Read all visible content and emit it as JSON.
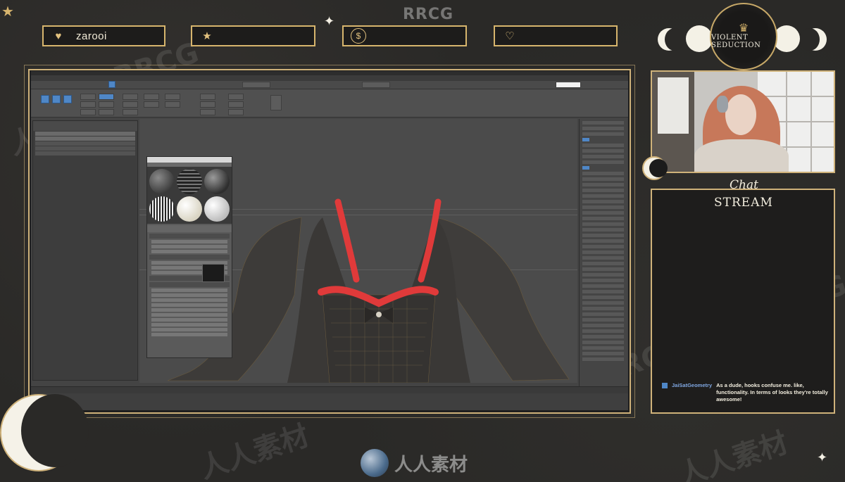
{
  "overlay": {
    "alerts": [
      {
        "icon": "heart-icon",
        "glyph": "♥",
        "label": "zarooi"
      },
      {
        "icon": "star-icon",
        "glyph": "★",
        "label": ""
      },
      {
        "icon": "dollar-icon",
        "glyph": "$",
        "label": ""
      },
      {
        "icon": "gift-hand-icon",
        "glyph": "♡",
        "label": ""
      }
    ],
    "brand": {
      "title": "VIOLENT SEDUCTION"
    },
    "chat": {
      "title": "Chat",
      "subtitle": "STREAM",
      "messages": [
        {
          "user": "JaiSatGeometry",
          "text": "As a dude, hooks confuse me. like, functionality. In terms of looks they're totally awesome!"
        }
      ]
    },
    "colors": {
      "accent_gold": "#cfb27a",
      "background": "#2a2927",
      "moon": "#f4f1e6",
      "dress_trim": "#e03a3a"
    }
  },
  "watermarks": {
    "top": "RRCG",
    "bottom": "人人素材"
  }
}
